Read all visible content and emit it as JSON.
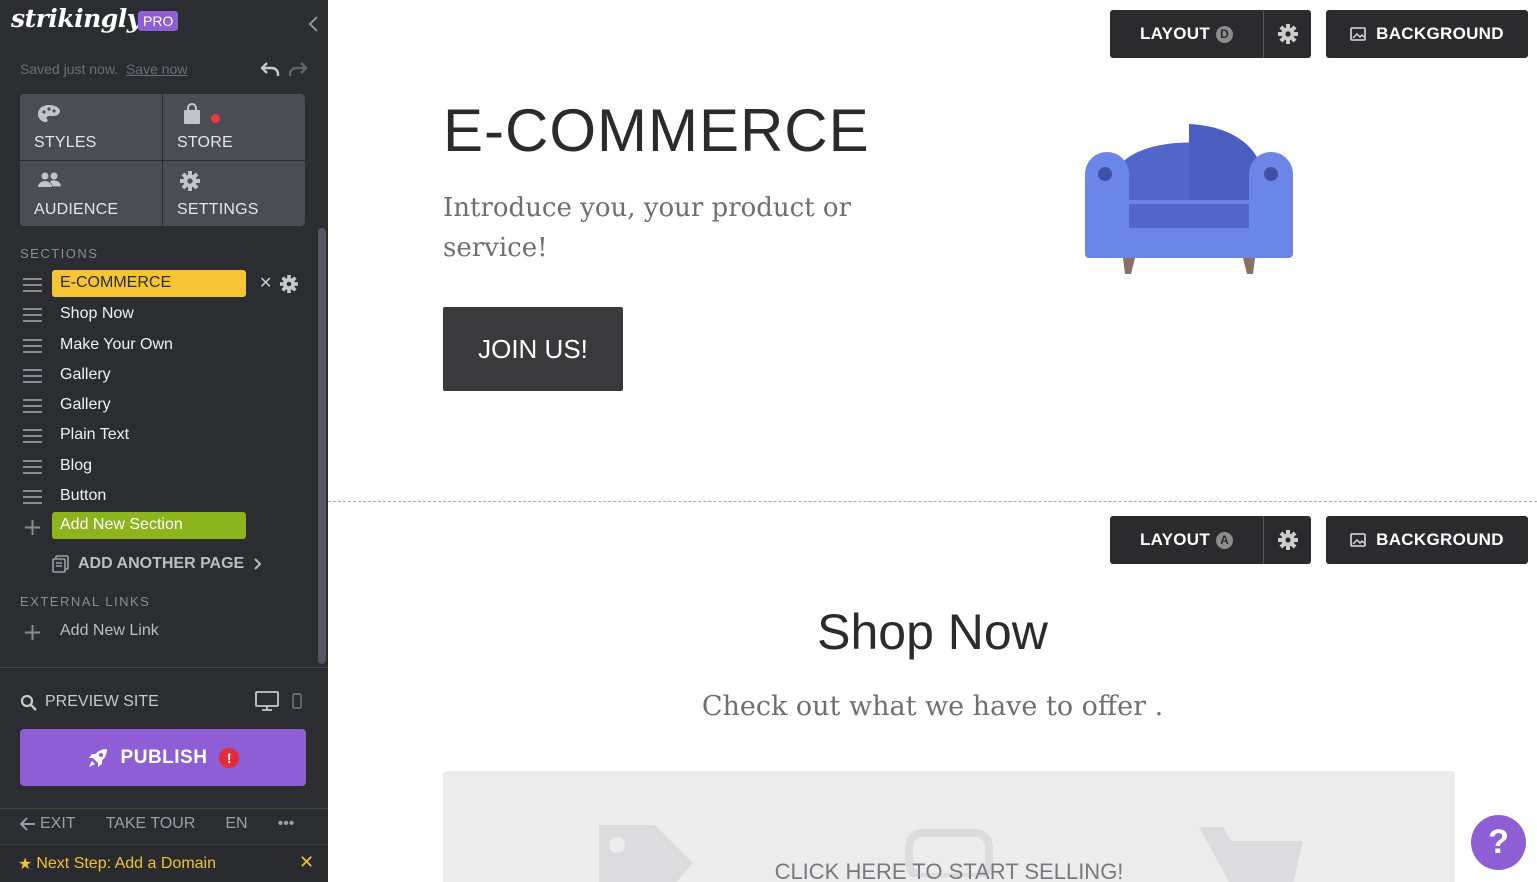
{
  "sidebar": {
    "logo": "strikingly",
    "pro_badge": "PRO",
    "saved_text": "Saved just now.",
    "save_now": "Save now",
    "tiles": [
      {
        "label": "STYLES",
        "icon": "palette-icon"
      },
      {
        "label": "STORE",
        "icon": "shopping-bag-icon"
      },
      {
        "label": "AUDIENCE",
        "icon": "people-icon"
      },
      {
        "label": "SETTINGS",
        "icon": "gear-icon"
      }
    ],
    "sections_header": "SECTIONS",
    "sections": [
      "E-COMMERCE",
      "Shop Now",
      "Make Your Own",
      "Gallery",
      "Gallery",
      "Plain Text",
      "Blog",
      "Button"
    ],
    "add_section": "Add New Section",
    "add_page": "ADD ANOTHER PAGE",
    "external_header": "EXTERNAL LINKS",
    "add_link": "Add New Link",
    "preview": "PREVIEW SITE",
    "publish": "PUBLISH",
    "publish_alert": "!",
    "bottom": {
      "exit": "EXIT",
      "tour": "TAKE TOUR",
      "lang": "EN",
      "more": "•••"
    },
    "next_step": "Next Step: Add a Domain",
    "next_close": "✕",
    "close_x": "✕"
  },
  "toolbar1": {
    "layout": "LAYOUT",
    "layout_letter": "D",
    "background": "BACKGROUND"
  },
  "toolbar2": {
    "layout": "LAYOUT",
    "layout_letter": "A",
    "background": "BACKGROUND"
  },
  "hero": {
    "title": "E-COMMERCE",
    "subtitle": "Introduce you, your product or service!",
    "button": "JOIN US!"
  },
  "shop": {
    "title": "Shop Now",
    "subtitle": "Check out what we have to offer .",
    "cta": "CLICK HERE TO START SELLING!"
  },
  "help": "?",
  "colors": {
    "sidebar_bg": "#2c2d31",
    "tile_bg": "#4b4d55",
    "active_section": "#f5c536",
    "add_section": "#8db31d",
    "publish": "#8e5fd4",
    "alert": "#e52a38",
    "chair": "#6a84e8"
  }
}
